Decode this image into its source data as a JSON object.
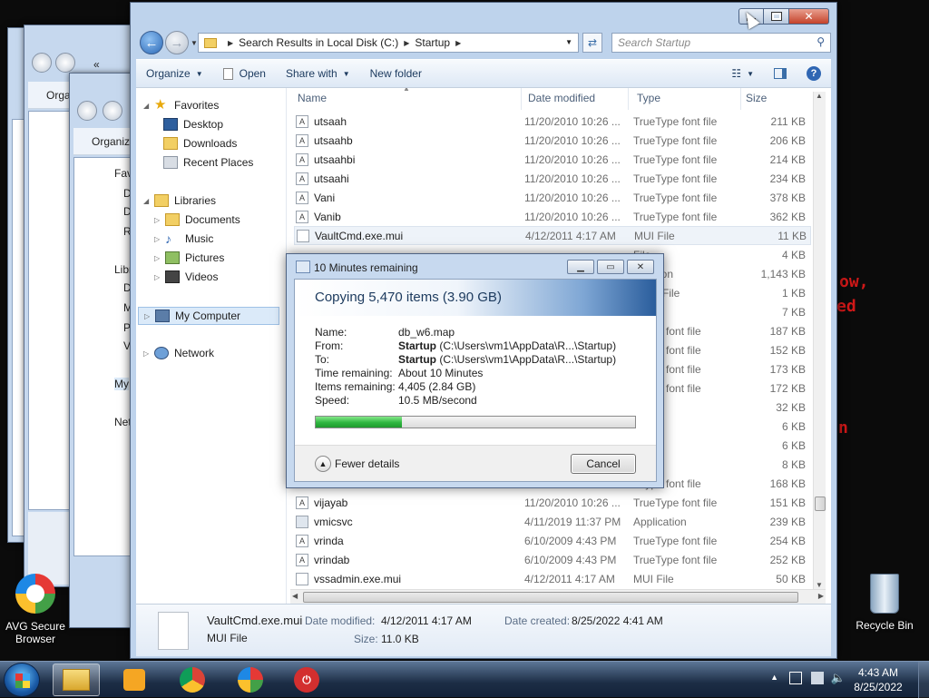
{
  "desktop": {
    "red_fragments": [
      "ow,",
      "ed",
      "n"
    ],
    "icons": [
      {
        "label_line1": "AVG Secure",
        "label_line2": "Browser"
      },
      {
        "label_line1": "Recycle Bin",
        "label_line2": ""
      }
    ]
  },
  "bg_windows": {
    "w1": {
      "nav_arrow": "«",
      "organize": "Orga"
    },
    "w2": {
      "organize": "Organiz",
      "items": [
        "Favo",
        "D",
        "D",
        "R",
        "Libr",
        "D",
        "M",
        "P",
        "V",
        "My",
        "Net"
      ]
    },
    "w3": {
      "items": [
        "My"
      ]
    }
  },
  "explorer": {
    "address": {
      "segments": [
        "Search Results in Local Disk (C:)",
        "Startup"
      ],
      "search_placeholder": "Search Startup"
    },
    "toolbar": {
      "organize": "Organize",
      "open": "Open",
      "share_with": "Share with",
      "new_folder": "New folder"
    },
    "nav": {
      "favorites": "Favorites",
      "desktop": "Desktop",
      "downloads": "Downloads",
      "recent_places": "Recent Places",
      "libraries": "Libraries",
      "documents": "Documents",
      "music": "Music",
      "pictures": "Pictures",
      "videos": "Videos",
      "my_computer": "My Computer",
      "network": "Network"
    },
    "columns": {
      "name": "Name",
      "date": "Date modified",
      "type": "Type",
      "size": "Size"
    },
    "files": [
      {
        "name": "utsaah",
        "date": "11/20/2010 10:26 ...",
        "type": "TrueType font file",
        "size": "211 KB",
        "icon": "font-file"
      },
      {
        "name": "utsaahb",
        "date": "11/20/2010 10:26 ...",
        "type": "TrueType font file",
        "size": "206 KB",
        "icon": "font-file"
      },
      {
        "name": "utsaahbi",
        "date": "11/20/2010 10:26 ...",
        "type": "TrueType font file",
        "size": "214 KB",
        "icon": "font-file"
      },
      {
        "name": "utsaahi",
        "date": "11/20/2010 10:26 ...",
        "type": "TrueType font file",
        "size": "234 KB",
        "icon": "font-file"
      },
      {
        "name": "Vani",
        "date": "11/20/2010 10:26 ...",
        "type": "TrueType font file",
        "size": "378 KB",
        "icon": "font-file"
      },
      {
        "name": "Vanib",
        "date": "11/20/2010 10:26 ...",
        "type": "TrueType font file",
        "size": "362 KB",
        "icon": "font-file"
      },
      {
        "name": "VaultCmd.exe.mui",
        "date": "4/12/2011 4:17 AM",
        "type": "MUI File",
        "size": "11 KB",
        "icon": "mui-file"
      },
      {
        "name": "",
        "date": "",
        "type": "File",
        "size": "4 KB",
        "icon": ""
      },
      {
        "name": "",
        "date": "",
        "type": "plication",
        "size": "1,143 KB",
        "icon": ""
      },
      {
        "name": "",
        "date": "",
        "type": "NFIG File",
        "size": "1 KB",
        "icon": ""
      },
      {
        "name": "",
        "date": "",
        "type": "File",
        "size": "7 KB",
        "icon": ""
      },
      {
        "name": "",
        "date": "",
        "type": "eType font file",
        "size": "187 KB",
        "icon": ""
      },
      {
        "name": "",
        "date": "",
        "type": "eType font file",
        "size": "152 KB",
        "icon": ""
      },
      {
        "name": "",
        "date": "",
        "type": "eType font file",
        "size": "173 KB",
        "icon": ""
      },
      {
        "name": "",
        "date": "",
        "type": "eType font file",
        "size": "172 KB",
        "icon": ""
      },
      {
        "name": "",
        "date": "",
        "type": "File",
        "size": "32 KB",
        "icon": ""
      },
      {
        "name": "",
        "date": "",
        "type": "file",
        "size": "6 KB",
        "icon": ""
      },
      {
        "name": "",
        "date": "",
        "type": "file",
        "size": "6 KB",
        "icon": ""
      },
      {
        "name": "",
        "date": "",
        "type": "file",
        "size": "8 KB",
        "icon": ""
      },
      {
        "name": "",
        "date": "",
        "type": "eType font file",
        "size": "168 KB",
        "icon": ""
      },
      {
        "name": "vijayab",
        "date": "11/20/2010 10:26 ...",
        "type": "TrueType font file",
        "size": "151 KB",
        "icon": "font-file"
      },
      {
        "name": "vmicsvc",
        "date": "4/11/2019 11:37 PM",
        "type": "Application",
        "size": "239 KB",
        "icon": "app-file"
      },
      {
        "name": "vrinda",
        "date": "6/10/2009 4:43 PM",
        "type": "TrueType font file",
        "size": "254 KB",
        "icon": "font-file"
      },
      {
        "name": "vrindab",
        "date": "6/10/2009 4:43 PM",
        "type": "TrueType font file",
        "size": "252 KB",
        "icon": "font-file"
      },
      {
        "name": "vssadmin.exe.mui",
        "date": "4/12/2011 4:17 AM",
        "type": "MUI File",
        "size": "50 KB",
        "icon": "mui-file"
      }
    ],
    "details": {
      "filename": "VaultCmd.exe.mui",
      "filetype": "MUI File",
      "date_modified_label": "Date modified:",
      "date_modified": "4/12/2011 4:17 AM",
      "date_created_label": "Date created:",
      "date_created": "8/25/2022 4:41 AM",
      "size_label": "Size:",
      "size": "11.0 KB"
    }
  },
  "copy_dialog": {
    "title": "10 Minutes remaining",
    "heading": "Copying 5,470 items (3.90 GB)",
    "name_label": "Name:",
    "name_value": "db_w6.map",
    "from_label": "From:",
    "from_bold": "Startup",
    "from_path": "(C:\\Users\\vm1\\AppData\\R...\\Startup)",
    "to_label": "To:",
    "to_bold": "Startup",
    "to_path": "(C:\\Users\\vm1\\AppData\\R...\\Startup)",
    "time_label": "Time remaining:",
    "time_value": "About 10 Minutes",
    "items_label": "Items remaining:",
    "items_value": "4,405 (2.84 GB)",
    "speed_label": "Speed:",
    "speed_value": "10.5 MB/second",
    "progress_fraction": 0.27,
    "fewer_details": "Fewer details",
    "cancel": "Cancel"
  },
  "taskbar": {
    "time": "4:43 AM",
    "date": "8/25/2022"
  }
}
